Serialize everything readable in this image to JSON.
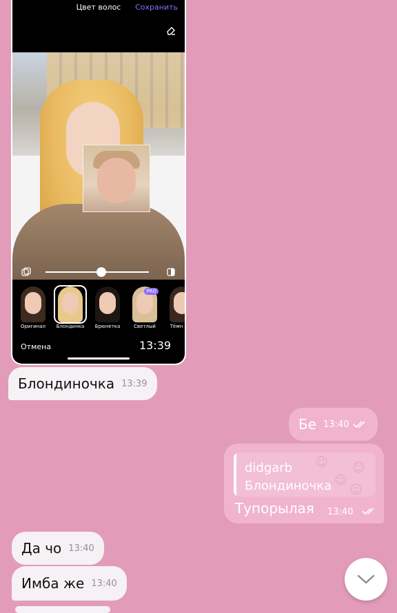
{
  "photo_message": {
    "editor_title": "Цвет волос",
    "save_label": "Сохранить",
    "cancel_label": "Отмена",
    "overlay_time": "13:39",
    "hair_styles": [
      {
        "label": "Оригинал",
        "pro": false,
        "hair_color": "#3d2b20"
      },
      {
        "label": "Блондинка",
        "pro": false,
        "hair_color": "#e9c98a",
        "selected": true
      },
      {
        "label": "Брюнетка",
        "pro": false,
        "hair_color": "#1e1612"
      },
      {
        "label": "Светлый",
        "pro": true,
        "hair_color": "#d9c09a",
        "pro_label": "PRO"
      },
      {
        "label": "Тёмн",
        "pro": true,
        "hair_color": "#3a2820"
      }
    ],
    "intensity_fraction": 0.54
  },
  "messages": [
    {
      "text": "Блондиночка",
      "time": "13:39",
      "direction": "in"
    },
    {
      "text": "Бе",
      "time": "13:40",
      "direction": "out"
    },
    {
      "text": "Тупорылая",
      "time": "13:40",
      "direction": "out",
      "reply": {
        "author": "didgarb",
        "text": "Блондиночка"
      }
    },
    {
      "text": "Да чо",
      "time": "13:40",
      "direction": "in"
    },
    {
      "text": "Имба же",
      "time": "13:40",
      "direction": "in"
    }
  ],
  "colors": {
    "background": "#e39bba",
    "incoming_bubble": "#f6f1f4",
    "outgoing_bubble": "#f0b4cf",
    "accent": "#8b6cff"
  },
  "icons": {
    "read_receipt": "double-check-icon",
    "scroll_down": "chevron-down-icon"
  }
}
